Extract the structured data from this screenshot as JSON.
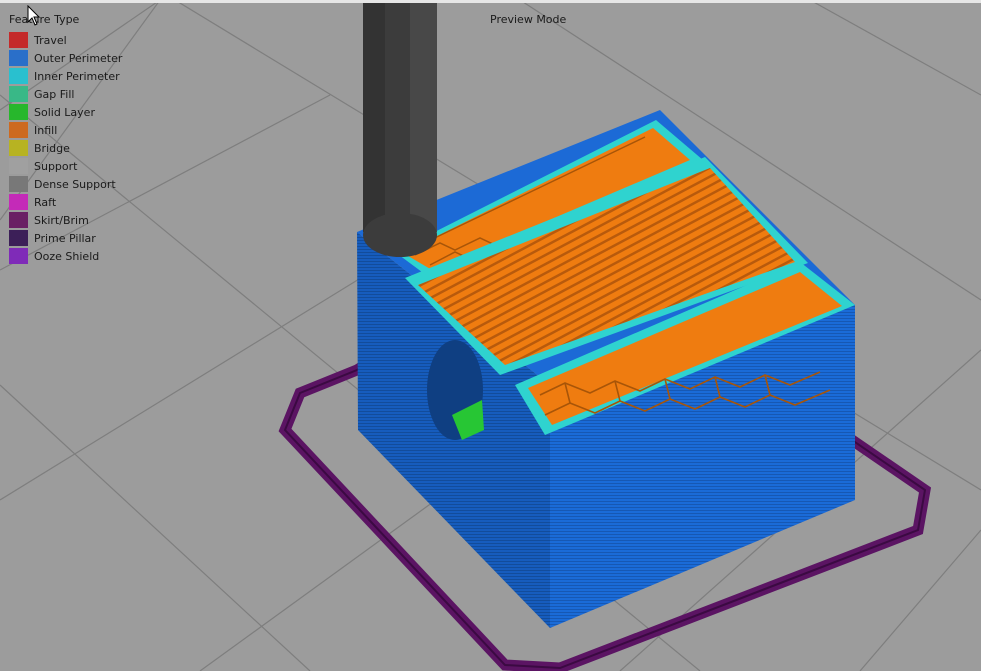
{
  "header": {
    "legend_title": "Feature Type",
    "mode_label": "Preview Mode"
  },
  "legend": {
    "items": [
      {
        "label": "Travel",
        "color": "#c42a2a"
      },
      {
        "label": "Outer Perimeter",
        "color": "#2a6fc9"
      },
      {
        "label": "Inner Perimeter",
        "color": "#29c0cf"
      },
      {
        "label": "Gap Fill",
        "color": "#39b887"
      },
      {
        "label": "Solid Layer",
        "color": "#27b72c"
      },
      {
        "label": "Infill",
        "color": "#cd6a20"
      },
      {
        "label": "Bridge",
        "color": "#b7b322"
      },
      {
        "label": "Support",
        "color": "#a0a0a0"
      },
      {
        "label": "Dense Support",
        "color": "#787878"
      },
      {
        "label": "Raft",
        "color": "#c42ab8"
      },
      {
        "label": "Skirt/Brim",
        "color": "#6a1f64"
      },
      {
        "label": "Prime Pillar",
        "color": "#3c1f58"
      },
      {
        "label": "Ooze Shield",
        "color": "#7f2bb8"
      }
    ]
  },
  "colors": {
    "background": "#9c9c9c",
    "grid": "#7e7e7e",
    "outer_perimeter": "#1c6ad6",
    "inner_perimeter": "#2fd3cf",
    "infill": "#ef7c10",
    "skirt": "#5b1463",
    "nozzle": "#3f3f3f"
  }
}
